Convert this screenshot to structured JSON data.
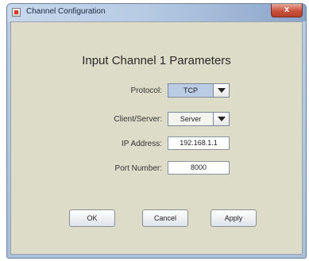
{
  "window": {
    "title": "Channel Configuration",
    "close_label": "x"
  },
  "heading": "Input Channel 1 Parameters",
  "form": {
    "protocol": {
      "label": "Protocol:",
      "value": "TCP"
    },
    "client_server": {
      "label": "Client/Server:",
      "value": "Server"
    },
    "ip_address": {
      "label": "IP Address:",
      "value": "192.168.1.1"
    },
    "port_number": {
      "label": "Port Number:",
      "value": "8000"
    }
  },
  "buttons": {
    "ok": "OK",
    "cancel": "Cancel",
    "apply": "Apply"
  }
}
